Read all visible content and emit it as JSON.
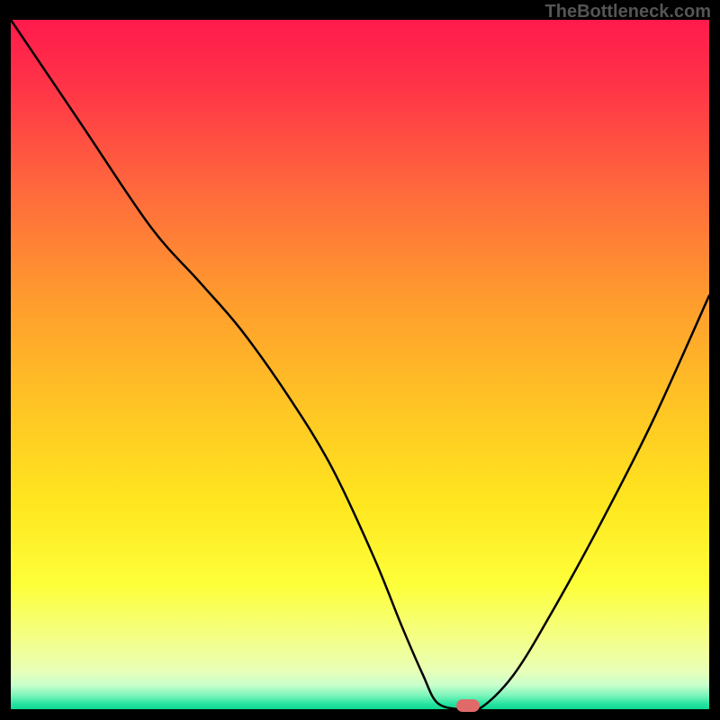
{
  "watermark": "TheBottleneck.com",
  "colors": {
    "frame": "#000000",
    "curve": "#000000",
    "marker": "#e06a6a"
  },
  "gradient_stops": [
    {
      "offset": 0.0,
      "color": "#ff1a4d"
    },
    {
      "offset": 0.1,
      "color": "#ff3547"
    },
    {
      "offset": 0.25,
      "color": "#ff6a3c"
    },
    {
      "offset": 0.4,
      "color": "#ff9a2e"
    },
    {
      "offset": 0.55,
      "color": "#ffc225"
    },
    {
      "offset": 0.7,
      "color": "#ffe61f"
    },
    {
      "offset": 0.82,
      "color": "#fdff3a"
    },
    {
      "offset": 0.9,
      "color": "#f3ff8a"
    },
    {
      "offset": 0.945,
      "color": "#e8ffb8"
    },
    {
      "offset": 0.965,
      "color": "#c8ffcc"
    },
    {
      "offset": 0.98,
      "color": "#7cf5bb"
    },
    {
      "offset": 0.993,
      "color": "#22e3a0"
    },
    {
      "offset": 1.0,
      "color": "#0fd88f"
    }
  ],
  "chart_data": {
    "type": "line",
    "title": "",
    "xlabel": "",
    "ylabel": "",
    "xlim": [
      0,
      100
    ],
    "ylim": [
      0,
      100
    ],
    "series": [
      {
        "name": "bottleneck-curve",
        "x": [
          0,
          10,
          20,
          27,
          33,
          40,
          46,
          52,
          56,
          59,
          61,
          64,
          67,
          72,
          78,
          85,
          92,
          100
        ],
        "y": [
          100,
          85,
          70,
          62,
          55,
          45,
          35,
          22,
          12,
          5,
          1,
          0,
          0,
          5,
          15,
          28,
          42,
          60
        ]
      }
    ],
    "marker": {
      "x": 65.5,
      "y": 0
    }
  }
}
